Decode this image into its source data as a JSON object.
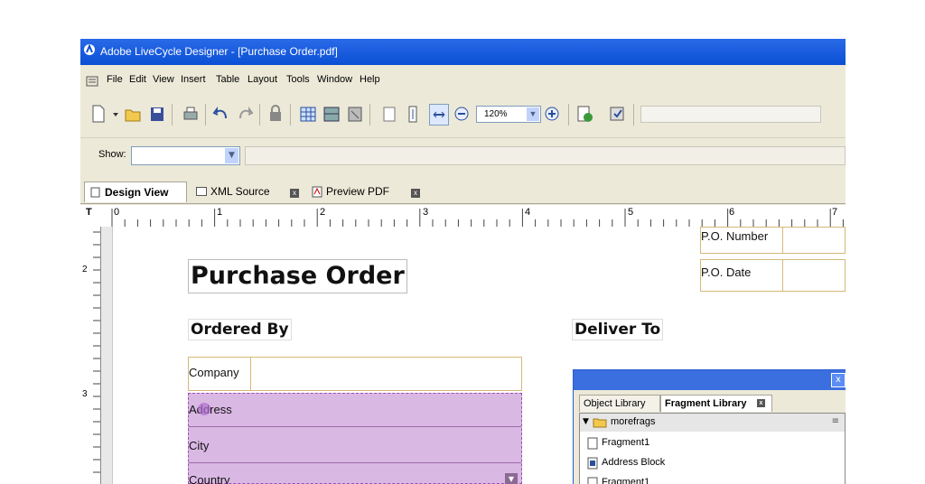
{
  "window": {
    "title": "Adobe LiveCycle Designer - [Purchase Order.pdf]"
  },
  "menu": [
    "File",
    "Edit",
    "View",
    "Insert",
    "Table",
    "Layout",
    "Tools",
    "Window",
    "Help"
  ],
  "toolbar": {
    "zoom": "120%"
  },
  "show_bar": {
    "label": "Show:",
    "value": ""
  },
  "tabs": [
    {
      "label": "Design View"
    },
    {
      "label": "XML Source"
    },
    {
      "label": "Preview PDF"
    }
  ],
  "ruler": {
    "h_numbers": [
      "0",
      "1",
      "2",
      "3",
      "4",
      "5",
      "6",
      "7"
    ],
    "v_numbers": [
      "2",
      "3"
    ]
  },
  "form": {
    "title": "Purchase Order",
    "ordered_by": "Ordered By",
    "deliver_to": "Deliver To",
    "po_number_label": "P.O. Number",
    "po_date_label": "P.O. Date",
    "company_label": "Company",
    "address_label": "Address",
    "city_label": "City",
    "country_label": "Country"
  },
  "fragment_panel": {
    "tabs": [
      "Object Library",
      "Fragment Library"
    ],
    "folder": "morefrags",
    "items": [
      "Fragment1",
      "Address Block",
      "Fragment1"
    ]
  },
  "colors": {
    "titlebar": "#0a4fd4",
    "selection": "#dab8e4",
    "field_border": "#d6b978"
  }
}
